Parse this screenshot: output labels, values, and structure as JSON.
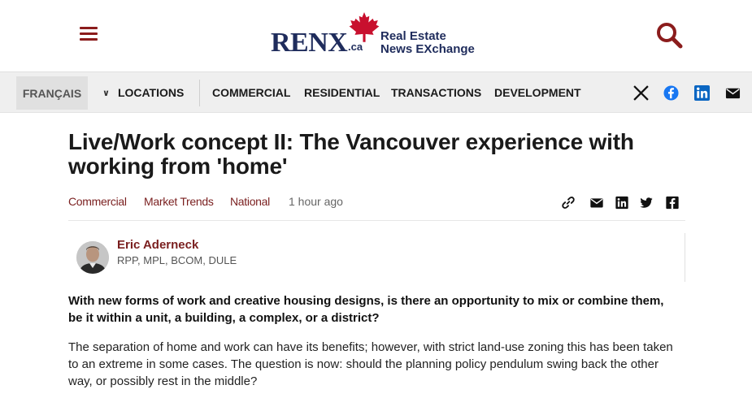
{
  "header": {
    "logo_text": "RENX",
    "logo_suffix": ".ca",
    "logo_tagline_1": "Real Estate",
    "logo_tagline_2": "News EXchange",
    "brand_color": "#1f2c5c",
    "accent_color": "#8b1c1c",
    "menu_icon": "hamburger-icon",
    "search_icon": "search-icon"
  },
  "nav": {
    "language": "FRANÇAIS",
    "locations": "LOCATIONS",
    "items": [
      "COMMERCIAL",
      "RESIDENTIAL",
      "TRANSACTIONS",
      "DEVELOPMENT"
    ],
    "social_icons": [
      "x-icon",
      "facebook-icon",
      "linkedin-icon",
      "email-icon"
    ]
  },
  "article": {
    "title": "Live/Work concept II: The Vancouver experience with working from 'home'",
    "categories": [
      "Commercial",
      "Market Trends",
      "National"
    ],
    "published": "1 hour ago",
    "share_icons": [
      "link-icon",
      "email-icon",
      "linkedin-icon",
      "twitter-icon",
      "facebook-icon"
    ],
    "author": {
      "name": "Eric Aderneck",
      "credentials": "RPP, MPL, BCOM, DULE"
    },
    "lede": "With new forms of work and creative housing designs, is there an opportunity to mix or combine them, be it within a unit, a building, a complex, or a district?",
    "paragraph_1": "The separation of home and work can have its benefits; however, with strict land-use zoning this has been taken to an extreme in some cases. The question is now: should the planning policy pendulum swing back the other way, or possibly rest in the middle?"
  }
}
